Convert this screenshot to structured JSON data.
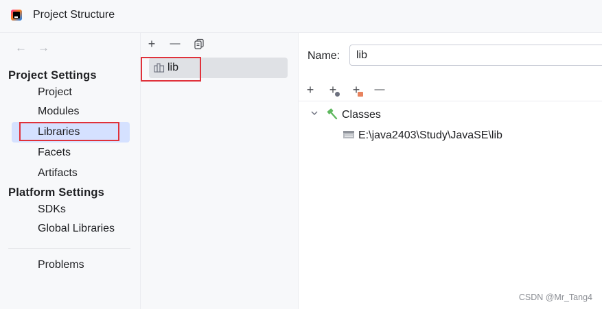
{
  "window": {
    "title": "Project Structure"
  },
  "sidebar": {
    "back_arrow": "←",
    "forward_arrow": "→",
    "project_settings_header": "Project Settings",
    "project_items": [
      "Project",
      "Modules",
      "Libraries",
      "Facets",
      "Artifacts"
    ],
    "selected_item": "Libraries",
    "platform_settings_header": "Platform Settings",
    "platform_items": [
      "SDKs",
      "Global Libraries"
    ],
    "problems_label": "Problems"
  },
  "library_panel": {
    "toolbar": {
      "add": "+",
      "remove": "—",
      "copy_icon": "copy-icon"
    },
    "libraries": [
      "lib"
    ]
  },
  "detail": {
    "name_label": "Name:",
    "name_value": "lib",
    "toolbar": {
      "add": "+",
      "add_specification": "+",
      "add_jar": "+",
      "remove": "—"
    },
    "tree": {
      "root_label": "Classes",
      "children": [
        "E:\\java2403\\Study\\JavaSE\\lib"
      ]
    }
  },
  "watermark": "CSDN @Mr_Tang4",
  "colors": {
    "selection": "#d5e1ff",
    "list_selection": "#dfe1e5",
    "highlight_border": "#e0313a",
    "hammer_green": "#5fb85f",
    "jar_orange": "#e8835f"
  }
}
